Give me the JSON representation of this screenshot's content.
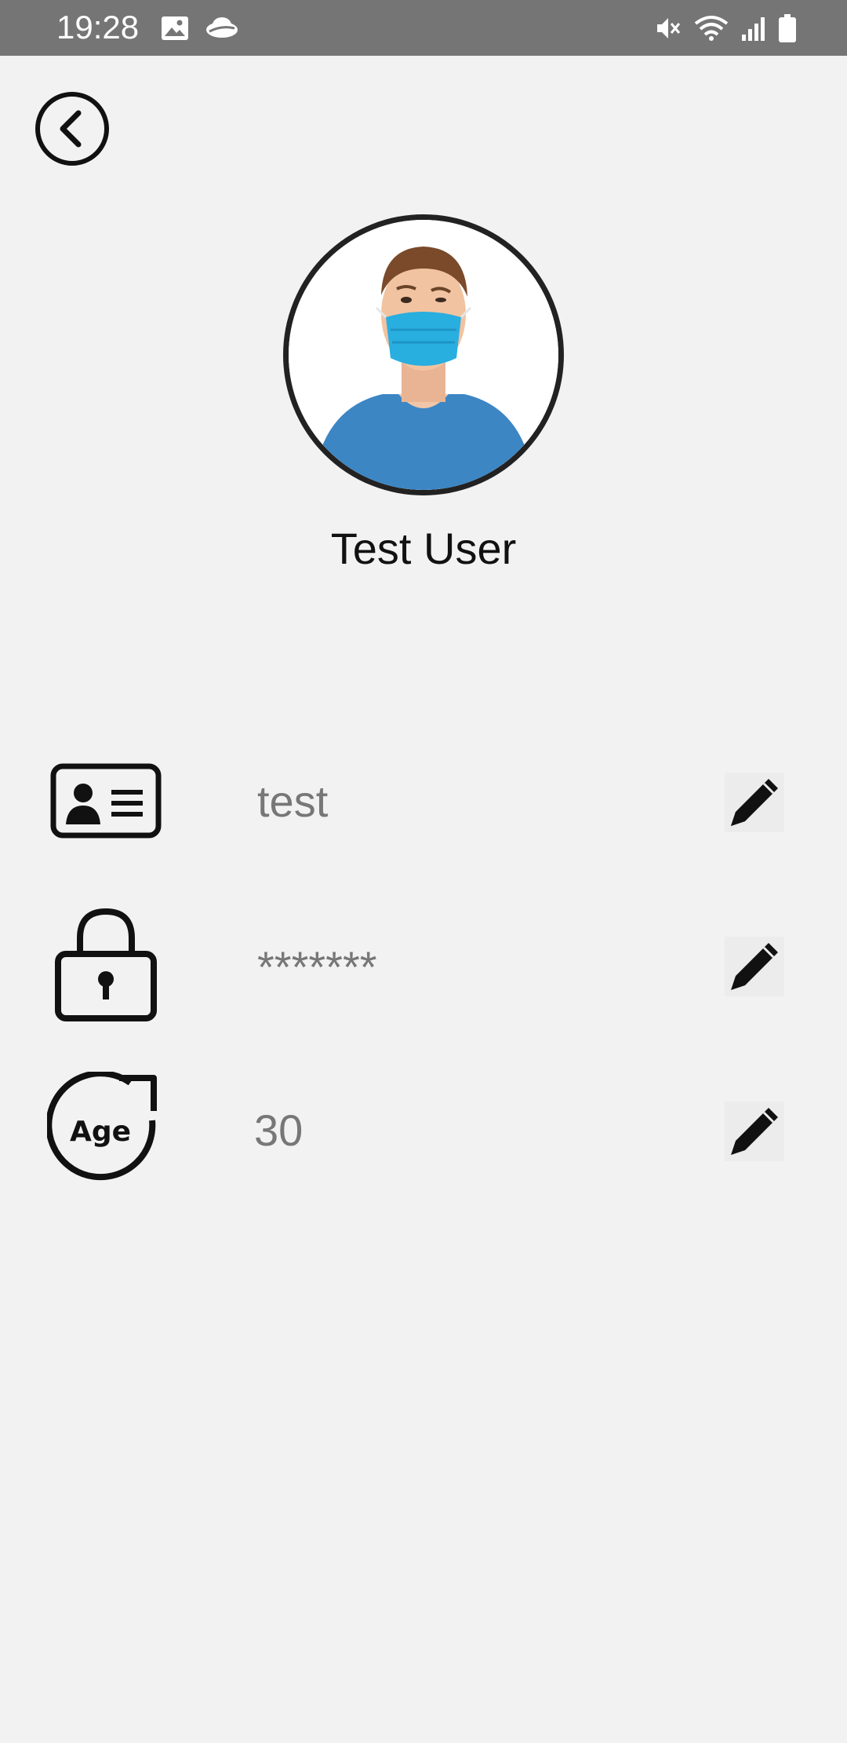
{
  "status_bar": {
    "time": "19:28",
    "left_icons": [
      "gallery-icon",
      "cloud-icon"
    ],
    "right_icons": [
      "mute-icon",
      "wifi-icon",
      "signal-icon",
      "battery-icon"
    ]
  },
  "profile": {
    "name": "Test User",
    "avatar_icon": "user-photo"
  },
  "fields": [
    {
      "icon": "id-card-icon",
      "value": "test",
      "edit_icon": "pencil-icon"
    },
    {
      "icon": "lock-icon",
      "value": "*******",
      "edit_icon": "pencil-icon"
    },
    {
      "icon": "age-icon",
      "value": "30",
      "icon_text": "Age",
      "edit_icon": "pencil-icon"
    }
  ],
  "colors": {
    "background": "#f2f2f2",
    "status_bar": "#757575",
    "value_text": "#777777",
    "name_text": "#111111"
  }
}
